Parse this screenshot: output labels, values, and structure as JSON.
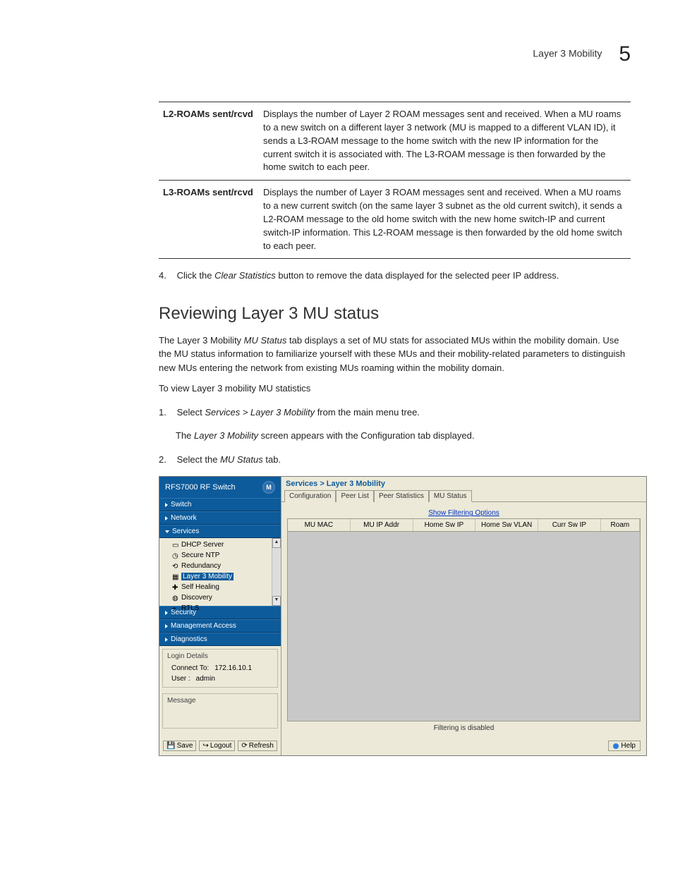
{
  "header": {
    "title": "Layer 3 Mobility",
    "chapter": "5"
  },
  "table": {
    "rows": [
      {
        "term": "L2-ROAMs sent/rcvd",
        "desc": "Displays the number of Layer 2 ROAM messages sent and received. When a MU roams to a new switch on a different layer 3 network (MU is mapped to a different VLAN ID), it sends a L3-ROAM message to the home switch with the new IP information for the current switch it is associated with. The L3-ROAM message is then forwarded by the home switch to each peer."
      },
      {
        "term": "L3-ROAMs sent/rcvd",
        "desc": "Displays the number of Layer 3 ROAM messages sent and received. When a MU roams to a new current switch (on the same layer 3 subnet as the old current switch), it sends a L2-ROAM message to the old home switch with the new home switch-IP and current switch-IP information. This L2-ROAM message is then forwarded by the old home switch to each peer."
      }
    ]
  },
  "step4": {
    "num": "4.",
    "pre": "Click the ",
    "em": "Clear Statistics",
    "post": " button to remove the data displayed for the selected peer IP address."
  },
  "section": {
    "title": "Reviewing Layer 3 MU status",
    "intro_pre": "The Layer 3 Mobility ",
    "intro_em": "MU Status",
    "intro_post": " tab displays a set of MU stats for associated MUs within the mobility domain. Use the MU status information to familiarize yourself with these MUs and their mobility-related parameters to distinguish new MUs entering the network from existing MUs roaming within the mobility domain.",
    "lead": "To view Layer 3 mobility MU statistics",
    "s1": {
      "num": "1.",
      "pre": "Select ",
      "em": "Services > Layer 3 Mobility",
      "post": " from the main menu tree."
    },
    "s1b": {
      "pre": "The ",
      "em": "Layer 3 Mobility",
      "post": " screen appears with the Configuration tab displayed."
    },
    "s2": {
      "num": "2.",
      "pre": "Select the ",
      "em": "MU Status",
      "post": " tab."
    }
  },
  "app": {
    "brand": "RFS7000 RF Switch",
    "logo": "M",
    "nav": {
      "switch": "Switch",
      "network": "Network",
      "services": "Services",
      "security": "Security",
      "mgmt": "Management Access",
      "diag": "Diagnostics"
    },
    "tree": {
      "dhcp": "DHCP Server",
      "ntp": "Secure NTP",
      "redundancy": "Redundancy",
      "l3": "Layer 3 Mobility",
      "selfheal": "Self Healing",
      "discovery": "Discovery",
      "rtls": "RTLS"
    },
    "login": {
      "title": "Login Details",
      "connect_lbl": "Connect To:",
      "connect_val": "172.16.10.1",
      "user_lbl": "User :",
      "user_val": "admin"
    },
    "message_title": "Message",
    "footer": {
      "save": "Save",
      "logout": "Logout",
      "refresh": "Refresh"
    },
    "crumb": "Services > Layer 3 Mobility",
    "tabs": {
      "config": "Configuration",
      "peerlist": "Peer List",
      "peerstats": "Peer Statistics",
      "mustatus": "MU Status"
    },
    "filter_link": "Show Filtering Options",
    "cols": {
      "mumac": "MU MAC",
      "muip": "MU IP Addr",
      "homeip": "Home Sw IP",
      "homevlan": "Home Sw VLAN",
      "currip": "Curr Sw IP",
      "roam": "Roam"
    },
    "filter_status": "Filtering is disabled",
    "help": "Help"
  }
}
